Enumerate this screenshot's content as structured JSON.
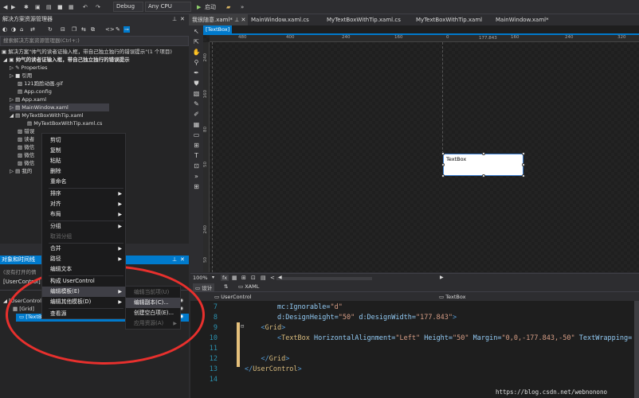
{
  "toolbar": {
    "config": "Debug",
    "platform": "Any CPU",
    "start": "启动"
  },
  "solution": {
    "title": "解决方案资源管理器",
    "search_placeholder": "搜索解决方案资源管理器(Ctrl+;)",
    "items": [
      {
        "label": "解决方案\"帅气的读者证输入框，带自己独立独行的错误提示\"(1 个项目)"
      },
      {
        "label": "帅气的读者证输入框，带自己独立独行的错误提示"
      },
      {
        "label": "Properties"
      },
      {
        "label": "引用"
      },
      {
        "label": "121跑脸动画.gif"
      },
      {
        "label": "App.config"
      },
      {
        "label": "App.xaml"
      },
      {
        "label": "MainWindow.xaml"
      },
      {
        "label": "MyTextBoxWithTip.xaml"
      },
      {
        "label": "MyTextBoxWithTip.xaml.cs"
      },
      {
        "label": "错误"
      },
      {
        "label": "读者"
      },
      {
        "label": "微信"
      },
      {
        "label": "微信"
      },
      {
        "label": "微信"
      },
      {
        "label": "我的"
      }
    ]
  },
  "outline": {
    "title": "对象和时间线",
    "search_text": "(没有打开的情",
    "root": "[UserControl]",
    "items": [
      {
        "label": "[UserControl"
      },
      {
        "label": "[Grid]"
      },
      {
        "label": "[TextBox]"
      }
    ]
  },
  "doc_tabs": [
    {
      "label": "我很随意.xaml*",
      "active": true
    },
    {
      "label": "MainWindow.xaml.cs",
      "active": false
    },
    {
      "label": "MyTextBoxWithTip.xaml.cs",
      "active": false
    },
    {
      "label": "MyTextBoxWithTip.xaml",
      "active": false
    },
    {
      "label": "MainWindow.xaml*",
      "active": false
    }
  ],
  "sub_tab": "[TextBox]",
  "ruler": {
    "top": [
      "480",
      "400",
      "320",
      "240",
      "160",
      "80",
      "0",
      "80",
      "160",
      "240",
      "320"
    ],
    "left": [
      "240",
      "50",
      "160",
      "80",
      "240",
      "50"
    ],
    "width_readout": "177.843"
  },
  "textbox_text": "TextBox",
  "zoom": "100%",
  "split_tabs": {
    "design": "设计",
    "xaml": "XAML"
  },
  "nav": {
    "left": "UserControl",
    "right": "TextBox"
  },
  "code_lines": [
    {
      "num": "7",
      "parts": [
        {
          "t": "        ",
          "c": ""
        },
        {
          "t": "mc:Ignorable=",
          "c": "tok-attr"
        },
        {
          "t": "\"d\"",
          "c": "tok-str"
        }
      ]
    },
    {
      "num": "8",
      "parts": [
        {
          "t": "        ",
          "c": ""
        },
        {
          "t": "d:DesignHeight=",
          "c": "tok-attr"
        },
        {
          "t": "\"50\"",
          "c": "tok-str"
        },
        {
          "t": " d:DesignWidth=",
          "c": "tok-attr"
        },
        {
          "t": "\"177.843\"",
          "c": "tok-str"
        },
        {
          "t": ">",
          "c": "tok-tag"
        }
      ]
    },
    {
      "num": "9",
      "parts": [
        {
          "t": "    ",
          "c": ""
        },
        {
          "t": "<",
          "c": "tok-tag"
        },
        {
          "t": "Grid",
          "c": "tok-el"
        },
        {
          "t": ">",
          "c": "tok-tag"
        }
      ]
    },
    {
      "num": "10",
      "parts": [
        {
          "t": "        ",
          "c": ""
        },
        {
          "t": "<",
          "c": "tok-tag"
        },
        {
          "t": "TextBox",
          "c": "tok-el"
        },
        {
          "t": " HorizontalAlignment=",
          "c": "tok-attr"
        },
        {
          "t": "\"Left\"",
          "c": "tok-str"
        },
        {
          "t": " Height=",
          "c": "tok-attr"
        },
        {
          "t": "\"50\"",
          "c": "tok-str"
        },
        {
          "t": " Margin=",
          "c": "tok-attr"
        },
        {
          "t": "\"0,0,-177.843,-50\"",
          "c": "tok-str"
        },
        {
          "t": " TextWrapping=",
          "c": "tok-attr"
        }
      ]
    },
    {
      "num": "11",
      "parts": [
        {
          "t": "",
          "c": ""
        }
      ]
    },
    {
      "num": "12",
      "parts": [
        {
          "t": "    ",
          "c": ""
        },
        {
          "t": "</",
          "c": "tok-tag"
        },
        {
          "t": "Grid",
          "c": "tok-el"
        },
        {
          "t": ">",
          "c": "tok-tag"
        }
      ]
    },
    {
      "num": "13",
      "parts": [
        {
          "t": "",
          "c": ""
        },
        {
          "t": "</",
          "c": "tok-tag"
        },
        {
          "t": "UserControl",
          "c": "tok-el"
        },
        {
          "t": ">",
          "c": "tok-tag"
        }
      ]
    },
    {
      "num": "14",
      "parts": [
        {
          "t": "",
          "c": ""
        }
      ]
    }
  ],
  "context_menu": [
    {
      "label": "剪切",
      "arrow": false
    },
    {
      "label": "复制",
      "arrow": false
    },
    {
      "label": "粘贴",
      "arrow": false
    },
    {
      "label": "删除",
      "arrow": false
    },
    {
      "label": "重命名",
      "arrow": false
    },
    {
      "label": "排序",
      "arrow": true
    },
    {
      "label": "对齐",
      "arrow": true
    },
    {
      "label": "布局",
      "arrow": true
    },
    {
      "label": "分组",
      "arrow": true
    },
    {
      "label": "取消分组",
      "arrow": false,
      "disabled": true
    },
    {
      "label": "合并",
      "arrow": true
    },
    {
      "label": "路径",
      "arrow": true
    },
    {
      "label": "编辑文本",
      "arrow": false
    },
    {
      "label": "构成 UserControl",
      "arrow": false
    },
    {
      "label": "编辑模板(E)",
      "arrow": true,
      "hl": true
    },
    {
      "label": "编辑其他模板(D)",
      "arrow": true
    },
    {
      "label": "查看源",
      "arrow": false
    }
  ],
  "submenu": [
    {
      "label": "编辑当前项(U)",
      "disabled": true
    },
    {
      "label": "编辑副本(C)...",
      "hl": true
    },
    {
      "label": "创建空白项(E)...",
      "disabled": false
    },
    {
      "label": "应用资源(A)",
      "disabled": true,
      "arrow": true
    }
  ],
  "watermark": "https://blog.csdn.net/webnonono"
}
